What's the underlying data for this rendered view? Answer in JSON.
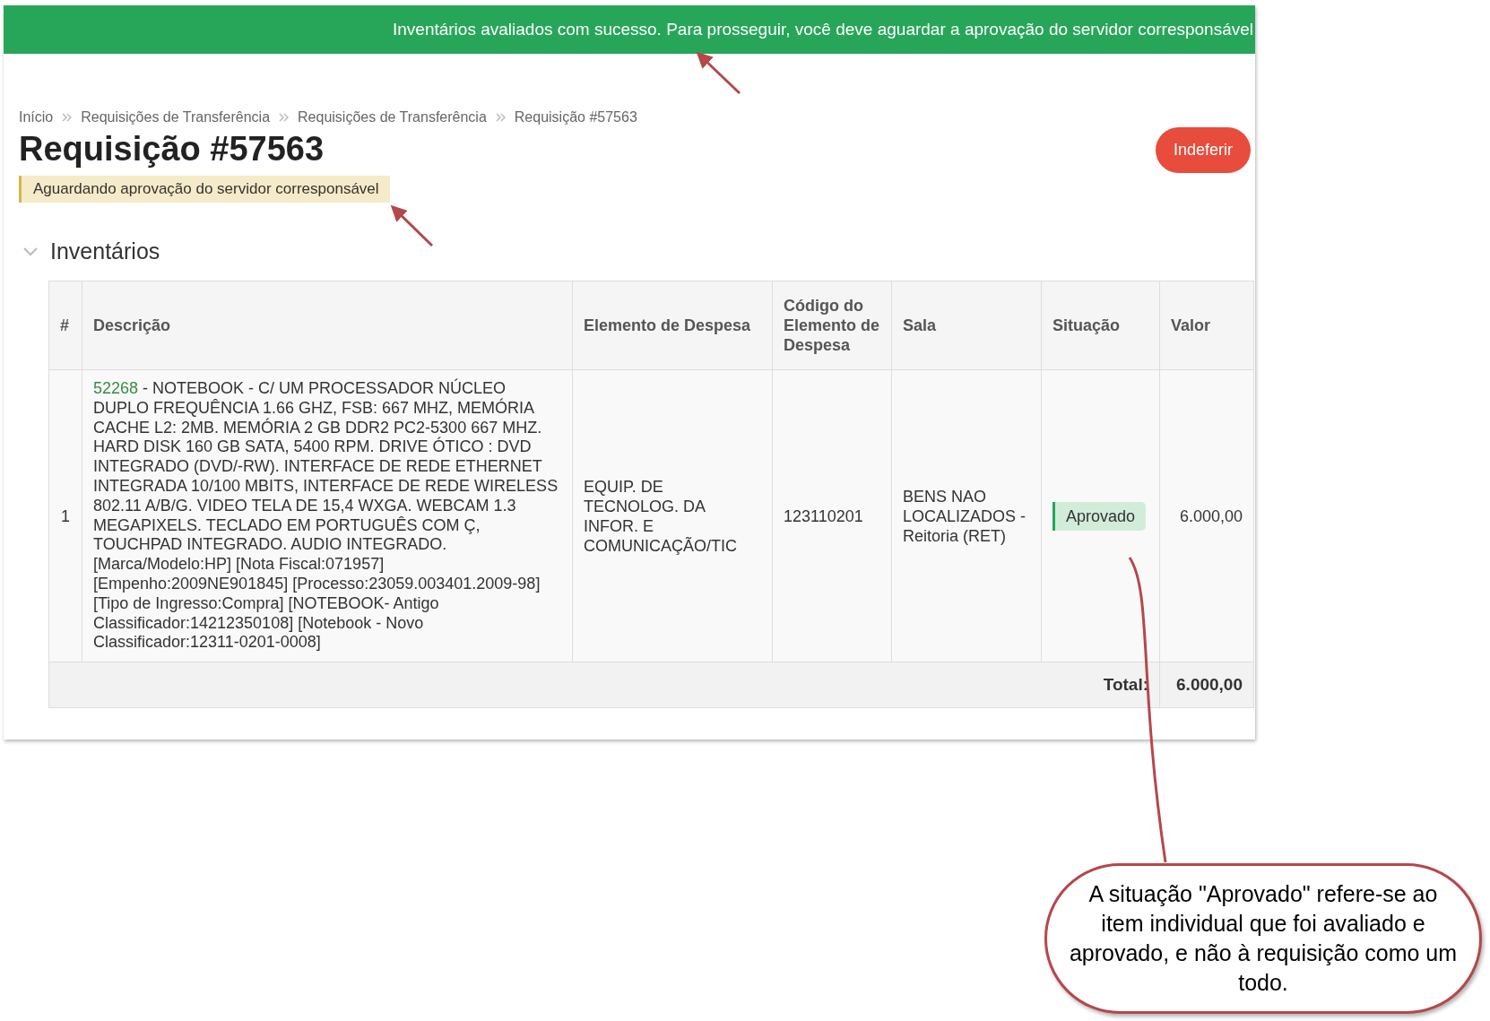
{
  "banner": {
    "message": "Inventários avaliados com sucesso. Para prosseguir, você deve aguardar a aprovação do servidor corresponsável"
  },
  "breadcrumb": [
    "Início",
    "Requisições de Transferência",
    "Requisições de Transferência",
    "Requisição #57563"
  ],
  "title": "Requisição #57563",
  "status_badge": "Aguardando aprovação do servidor corresponsável",
  "action_button": "Indeferir",
  "section": {
    "title": "Inventários",
    "expanded": true
  },
  "table": {
    "columns": [
      "#",
      "Descrição",
      "Elemento de Despesa",
      "Código do Elemento de Despesa",
      "Sala",
      "Situação",
      "Valor"
    ],
    "rows": [
      {
        "number": "1",
        "code": "52268",
        "description": " - NOTEBOOK - C/ UM PROCESSADOR NÚCLEO DUPLO FREQUÊNCIA 1.66 GHZ, FSB: 667 MHZ, MEMÓRIA CACHE L2: 2MB. MEMÓRIA 2 GB DDR2 PC2-5300 667 MHZ. HARD DISK 160 GB SATA, 5400 RPM. DRIVE ÓTICO : DVD INTEGRADO (DVD/-RW). INTERFACE DE REDE ETHERNET INTEGRADA 10/100 MBITS, INTERFACE DE REDE WIRELESS 802.11 A/B/G. VIDEO TELA DE 15,4 WXGA. WEBCAM 1.3 MEGAPIXELS. TECLADO EM PORTUGUÊS COM Ç, TOUCHPAD INTEGRADO. AUDIO INTEGRADO. [Marca/Modelo:HP] [Nota Fiscal:071957] [Empenho:2009NE901845] [Processo:23059.003401.2009-98] [Tipo de Ingresso:Compra] [NOTEBOOK- Antigo Classificador:14212350108] [Notebook - Novo Classificador:12311-0201-0008]",
        "element": "EQUIP. DE TECNOLOG. DA INFOR. E COMUNICAÇÃO/TIC",
        "element_code": "123110201",
        "room": "BENS NAO LOCALIZADOS - Reitoria (RET)",
        "status": "Aprovado",
        "value": "6.000,00"
      }
    ],
    "total_label": "Total:",
    "total": "6.000,00"
  },
  "callout": {
    "text": "A situação \"Aprovado\" refere-se ao item individual que foi avaliado e aprovado, e não à requisição como um todo."
  }
}
